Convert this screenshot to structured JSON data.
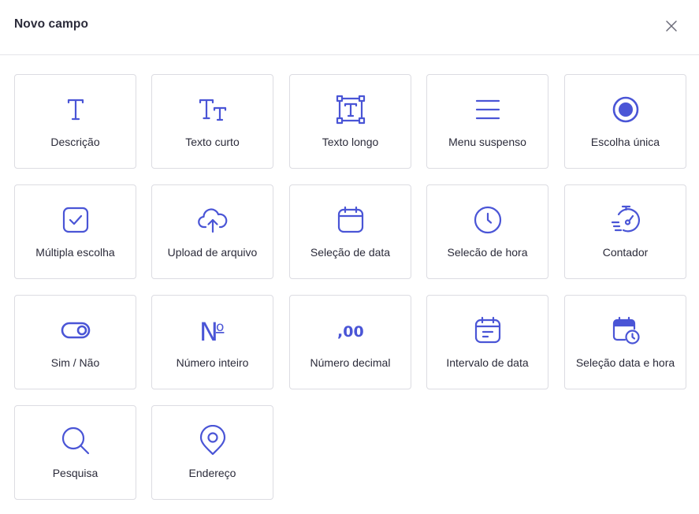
{
  "dialog": {
    "title": "Novo campo",
    "close_icon": "close-icon"
  },
  "accent_color": "#4a55d6",
  "field_types": [
    {
      "label": "Descrição",
      "icon": "text-icon"
    },
    {
      "label": "Texto curto",
      "icon": "text-size-icon"
    },
    {
      "label": "Texto longo",
      "icon": "text-box-icon"
    },
    {
      "label": "Menu suspenso",
      "icon": "menu-lines-icon"
    },
    {
      "label": "Escolha única",
      "icon": "radio-icon"
    },
    {
      "label": "Múltipla escolha",
      "icon": "checkbox-icon"
    },
    {
      "label": "Upload de arquivo",
      "icon": "cloud-upload-icon"
    },
    {
      "label": "Seleção de data",
      "icon": "calendar-icon"
    },
    {
      "label": "Selecão de hora",
      "icon": "clock-icon"
    },
    {
      "label": "Contador",
      "icon": "stopwatch-icon"
    },
    {
      "label": "Sim / Não",
      "icon": "toggle-icon"
    },
    {
      "label": "Número inteiro",
      "icon": "numero-sign-icon"
    },
    {
      "label": "Número decimal",
      "icon": "decimal-icon"
    },
    {
      "label": "Intervalo de data",
      "icon": "calendar-range-icon"
    },
    {
      "label": "Seleção data e hora",
      "icon": "calendar-clock-icon"
    },
    {
      "label": "Pesquisa",
      "icon": "search-icon"
    },
    {
      "label": "Endereço",
      "icon": "location-pin-icon"
    }
  ],
  "glyphs": {
    "decimal": ",00",
    "numero_n": "N",
    "numero_o": "o"
  }
}
